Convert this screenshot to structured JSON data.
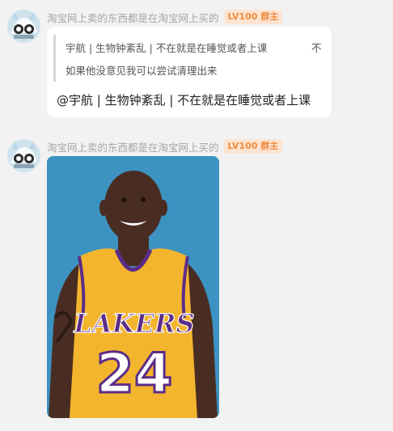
{
  "messages": [
    {
      "sender": "淘宝网上卖的东西都是在淘宝网上买的",
      "badge": "LV100 群主",
      "quote": {
        "line1": "宇航 | 生物钟紊乱 | 不在就是在睡觉或者上课",
        "line1_tail": "不",
        "line2": "如果他没意见我可以尝试清理出来"
      },
      "text": "@宇航 | 生物钟紊乱 | 不在就是在睡觉或者上课"
    },
    {
      "sender": "淘宝网上卖的东西都是在淘宝网上买的",
      "badge": "LV100 群主",
      "image": {
        "jersey_text": "LAKERS",
        "jersey_number": "24"
      }
    }
  ]
}
